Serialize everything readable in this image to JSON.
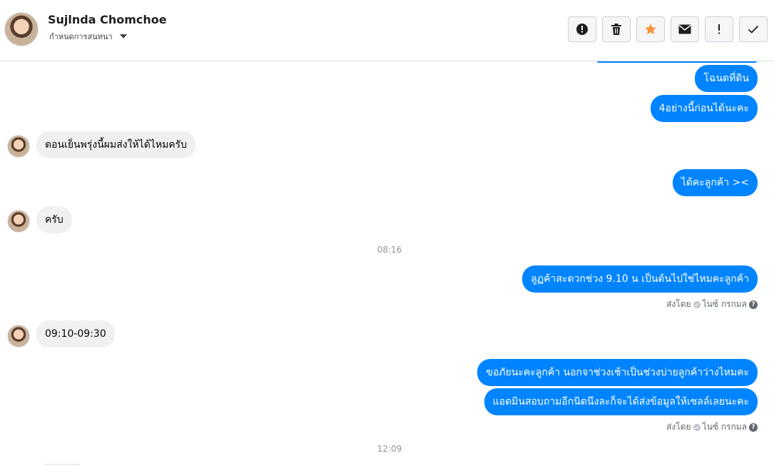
{
  "header": {
    "name": "Sujlnda Chomchoe",
    "subtitle": "กำหนดการสนทนา"
  },
  "toolbar": {
    "icons": [
      "alert-circle-icon",
      "trash-icon",
      "star-icon",
      "mail-icon",
      "exclamation-icon",
      "check-icon"
    ],
    "star_color": "#f7923a"
  },
  "messages": {
    "out1": "โฉนดที่ดิน",
    "out2": "4อย่างนี้ก่อนได้นะคะ",
    "in1": "ตอนเย็นพรุ่งนี้ผมส่งให้ได้ไหมครับ",
    "out3": "ได้คะลูกค้า ><",
    "in2": "ครับ",
    "time1": "08:16",
    "out4": "ลูฏค้าสะดวกช่วง 9.10 น เป็นต้นไปใช่ไหมคะลูกค้า",
    "sentby1": "ส่งโดย",
    "sender1": "ไนซ์ กรกมล",
    "in3": "09:10-09:30",
    "out5": "ขอภัยนะคะลูกค้า นอกจาช่วงเช้าเป็นช่วงบ่ายลูกค้าว่างไหมคะ",
    "out6": "แอดมินสอบถามอีกนิดนึงละก็จะได้ส่งข้อมูลให้เซลล์เลยนะคะ",
    "sentby2": "ส่งโดย",
    "sender2": "ไนซ์ กรกมล",
    "time2": "12:09"
  },
  "colors": {
    "outgoing": "#0084ff",
    "incoming": "#f1f0f0"
  }
}
